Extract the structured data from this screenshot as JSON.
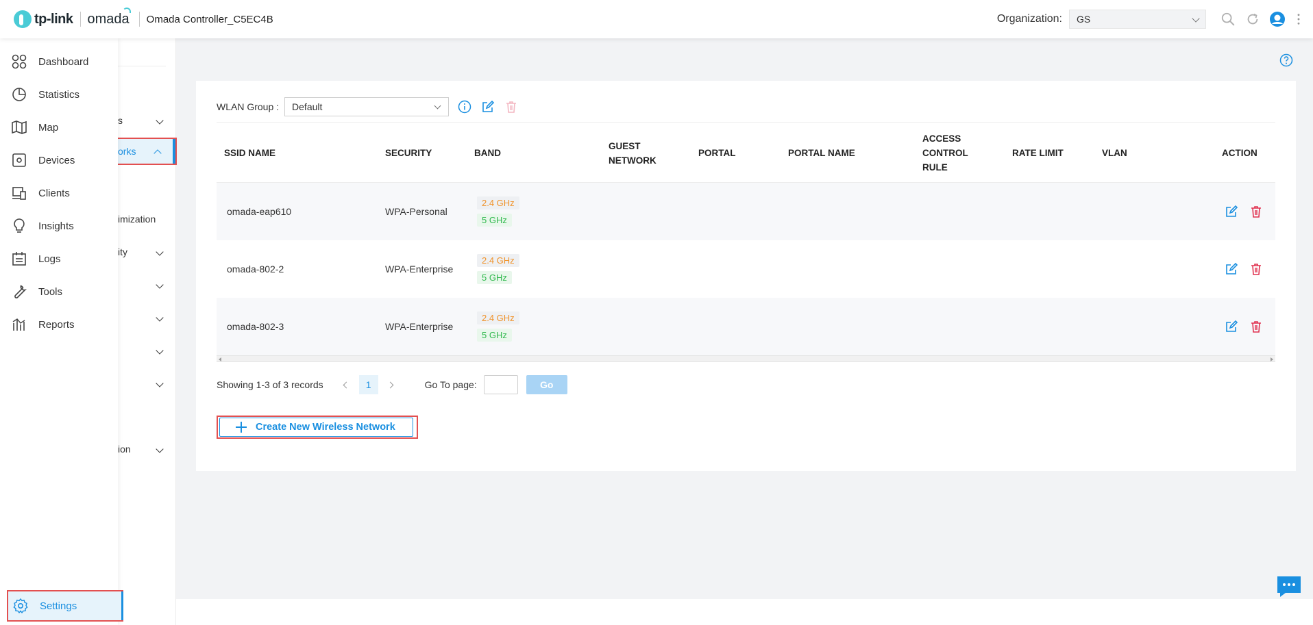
{
  "header": {
    "brand": "tp-link",
    "product": "omada",
    "controller_name": "Omada Controller_C5EC4B",
    "org_label": "Organization:",
    "org_value": "GS"
  },
  "nav": {
    "items": [
      {
        "label": "Dashboard",
        "icon": "dashboard-icon"
      },
      {
        "label": "Statistics",
        "icon": "statistics-icon"
      },
      {
        "label": "Map",
        "icon": "map-icon"
      },
      {
        "label": "Devices",
        "icon": "devices-icon"
      },
      {
        "label": "Clients",
        "icon": "clients-icon"
      },
      {
        "label": "Insights",
        "icon": "insights-icon"
      },
      {
        "label": "Logs",
        "icon": "logs-icon"
      },
      {
        "label": "Tools",
        "icon": "tools-icon"
      },
      {
        "label": "Reports",
        "icon": "reports-icon"
      }
    ],
    "settings_label": "Settings"
  },
  "sub_nav": {
    "items": [
      {
        "label": "s"
      },
      {
        "label": "orks"
      },
      {
        "label": "imization"
      },
      {
        "label": "ity"
      },
      {
        "label": ""
      },
      {
        "label": ""
      },
      {
        "label": ""
      },
      {
        "label": ""
      },
      {
        "label": "ion"
      }
    ]
  },
  "wlan": {
    "label": "WLAN Group :",
    "selected": "Default"
  },
  "table": {
    "columns": [
      "SSID NAME",
      "SECURITY",
      "BAND",
      "GUEST NETWORK",
      "PORTAL",
      "PORTAL NAME",
      "ACCESS CONTROL RULE",
      "RATE LIMIT",
      "VLAN",
      "ACTION"
    ],
    "rows": [
      {
        "ssid": "omada-eap610",
        "security": "WPA-Personal",
        "band24": "2.4 GHz",
        "band5": "5 GHz"
      },
      {
        "ssid": "omada-802-2",
        "security": "WPA-Enterprise",
        "band24": "2.4 GHz",
        "band5": "5 GHz"
      },
      {
        "ssid": "omada-802-3",
        "security": "WPA-Enterprise",
        "band24": "2.4 GHz",
        "band5": "5 GHz"
      }
    ]
  },
  "pager": {
    "records": "Showing 1-3 of 3 records",
    "current_page": "1",
    "goto_label": "Go To page:",
    "go_label": "Go"
  },
  "create_button_label": "Create New Wireless Network",
  "colors": {
    "accent": "#1a8fe0",
    "highlight_border": "#e35050",
    "band_24": "#f0932b",
    "band_5": "#2eb84b",
    "delete": "#e0304e"
  }
}
